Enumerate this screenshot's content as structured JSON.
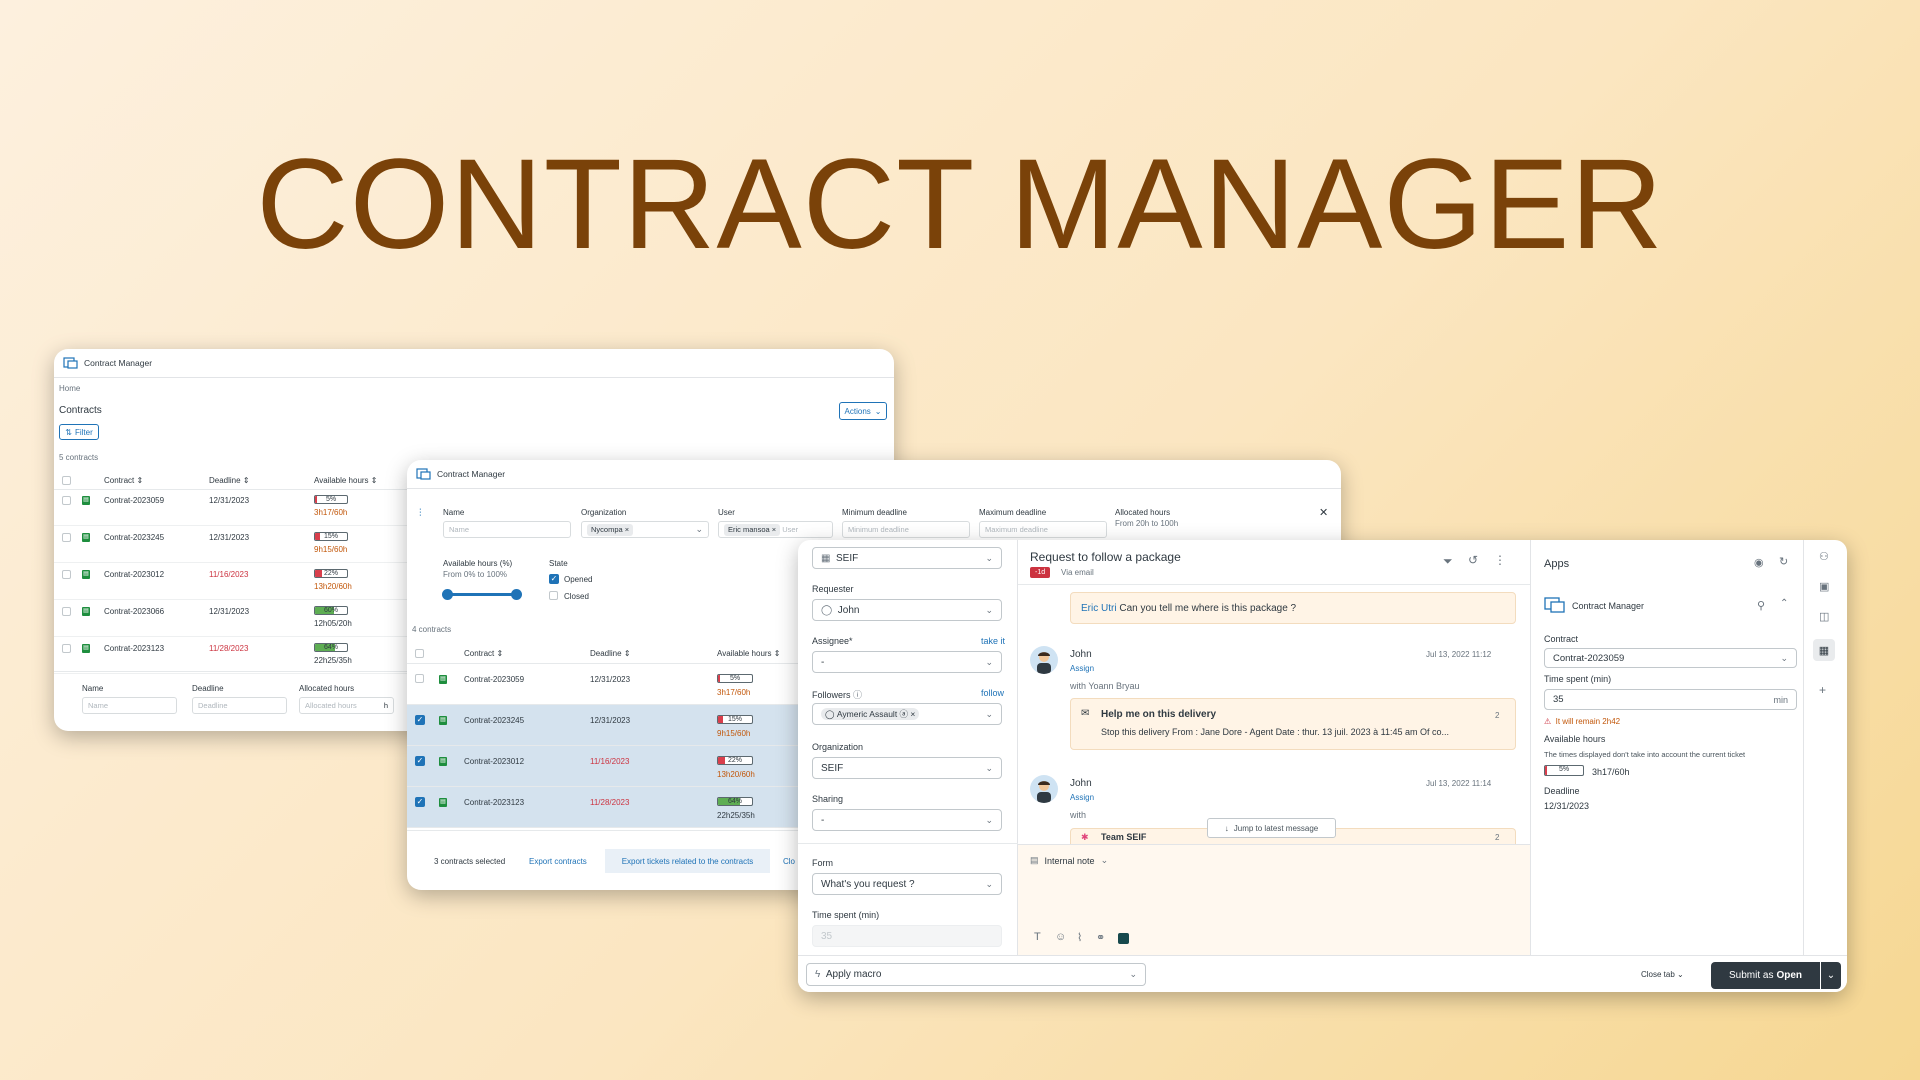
{
  "hero": {
    "title": "CONTRACT MANAGER"
  },
  "colors": {
    "accent": "#1f73b7",
    "hero": "#7a4209",
    "red_bar": "#d93f4c",
    "green_bar": "#5eae53"
  },
  "w1": {
    "app_title": "Contract Manager",
    "breadcrumb": "Home",
    "heading": "Contracts",
    "filter_label": "Filter",
    "actions_label": "Actions",
    "count": "5 contracts",
    "columns": [
      "Contract",
      "Deadline",
      "Available hours"
    ],
    "rows": [
      {
        "contract": "Contrat-2023059",
        "deadline": "12/31/2023",
        "pct": "5%",
        "pct_value": 5,
        "hours": "3h17/60h"
      },
      {
        "contract": "Contrat-2023245",
        "deadline": "12/31/2023",
        "pct": "15%",
        "pct_value": 15,
        "hours": "9h15/60h"
      },
      {
        "contract": "Contrat-2023012",
        "deadline": "11/16/2023",
        "pct": "22%",
        "pct_value": 22,
        "hours": "13h20/60h"
      },
      {
        "contract": "Contrat-2023066",
        "deadline": "12/31/2023",
        "pct": "60%",
        "pct_value": 60,
        "hours": "12h05/20h"
      },
      {
        "contract": "Contrat-2023123",
        "deadline": "11/28/2023",
        "pct": "64%",
        "pct_value": 64,
        "hours": "22h25/35h"
      }
    ],
    "footer_labels": {
      "name": "Name",
      "deadline": "Deadline",
      "allocated": "Allocated hours"
    },
    "footer_placeholders": {
      "name": "Name",
      "deadline": "Deadline",
      "allocated": "Allocated hours",
      "unit": "h"
    }
  },
  "w2": {
    "app_title": "Contract Manager",
    "filters": {
      "name_label": "Name",
      "name_placeholder": "Name",
      "org_label": "Organization",
      "org_tag": "Nycompa",
      "user_label": "User",
      "user_tag": "Eric mansoa",
      "user_placeholder": "User",
      "min_label": "Minimum deadline",
      "min_placeholder": "Minimum deadline",
      "max_label": "Maximum deadline",
      "max_placeholder": "Maximum deadline",
      "alloc_label": "Allocated hours",
      "alloc_sub": "From 20h to 100h",
      "avail_label": "Available hours (%)",
      "avail_sub": "From 0% to 100%",
      "state_label": "State",
      "state_opened": "Opened",
      "state_closed": "Closed"
    },
    "count": "4 contracts",
    "columns": [
      "Contract",
      "Deadline",
      "Available hours"
    ],
    "rows": [
      {
        "contract": "Contrat-2023059",
        "deadline": "12/31/2023",
        "pct": "5%",
        "pct_value": 5,
        "hours": "3h17/60h",
        "selected": false
      },
      {
        "contract": "Contrat-2023245",
        "deadline": "12/31/2023",
        "pct": "15%",
        "pct_value": 15,
        "hours": "9h15/60h",
        "selected": true
      },
      {
        "contract": "Contrat-2023012",
        "deadline": "11/16/2023",
        "pct": "22%",
        "pct_value": 22,
        "hours": "13h20/60h",
        "selected": true
      },
      {
        "contract": "Contrat-2023123",
        "deadline": "11/28/2023",
        "pct": "64%",
        "pct_value": 64,
        "hours": "22h25/35h",
        "selected": true
      }
    ],
    "selected_text": "3 contracts selected",
    "export_contracts": "Export contracts",
    "export_tickets": "Export tickets related to the contracts",
    "close_partial": "Clo"
  },
  "w3": {
    "left": {
      "brand_value": "SEIF",
      "requester_label": "Requester",
      "requester_value": "John",
      "assignee_label": "Assignee*",
      "take_it": "take it",
      "assignee_value": "-",
      "followers_label": "Followers",
      "follow": "follow",
      "follower_tag": "Aymeric Assault",
      "org_label": "Organization",
      "org_value": "SEIF",
      "sharing_label": "Sharing",
      "sharing_value": "-",
      "form_label": "Form",
      "form_value": "What's you request ?",
      "time_label": "Time spent (min)",
      "time_placeholder": "35"
    },
    "ticket": {
      "subject": "Request to follow a package",
      "badge": "-1d",
      "via": "Via email",
      "first_author": "Eric Utri",
      "first_text": "Can you tell me where is this package ?",
      "msg1": {
        "author": "John",
        "date": "Jul 13, 2022 11:12",
        "assign": "Assign",
        "with": "with Yoann Bryau",
        "card_title": "Help me on this delivery",
        "card_count": "2",
        "card_body": "Stop this delivery From : Jane Dore - Agent Date : thur. 13 juil. 2023 à 11:45 am Of co..."
      },
      "msg2": {
        "author": "John",
        "date": "Jul 13, 2022 11:14",
        "assign": "Assign",
        "with": "with",
        "card_title": "Team SEIF",
        "card_count": "2"
      },
      "jump": "Jump to latest message",
      "internal_note": "Internal note"
    },
    "apps": {
      "title": "Apps",
      "app_name": "Contract Manager",
      "contract_label": "Contract",
      "contract_value": "Contrat-2023059",
      "time_label": "Time spent (min)",
      "time_value": "35",
      "time_unit": "min",
      "warning": "It will remain 2h42",
      "avail_label": "Available hours",
      "avail_note": "The times displayed don't take into account the current ticket",
      "avail_pct": "5%",
      "avail_pct_value": 5,
      "avail_hours": "3h17/60h",
      "deadline_label": "Deadline",
      "deadline_value": "12/31/2023"
    },
    "bottom": {
      "macro": "Apply macro",
      "close_tab": "Close tab",
      "submit_prefix": "Submit as",
      "submit_status": "Open"
    }
  }
}
